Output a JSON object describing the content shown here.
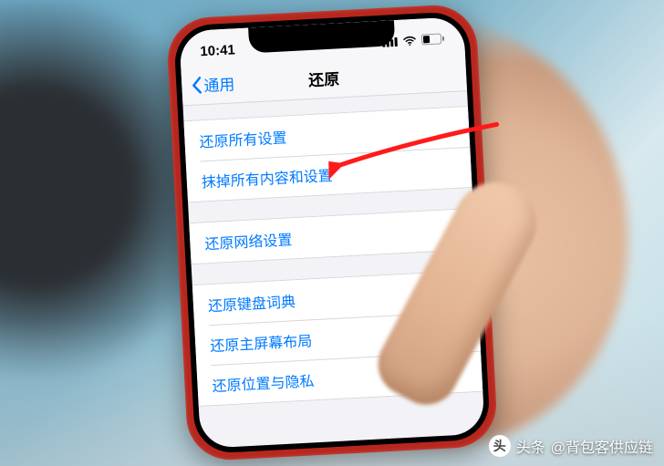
{
  "status_bar": {
    "time": "10:41"
  },
  "nav": {
    "back_label": "通用",
    "title": "还原"
  },
  "groups": [
    {
      "rows": [
        {
          "label": "还原所有设置"
        },
        {
          "label": "抹掉所有内容和设置"
        }
      ]
    },
    {
      "rows": [
        {
          "label": "还原网络设置"
        }
      ]
    },
    {
      "rows": [
        {
          "label": "还原键盘词典"
        },
        {
          "label": "还原主屏幕布局"
        },
        {
          "label": "还原位置与隐私"
        }
      ]
    }
  ],
  "attribution": {
    "prefix": "头条",
    "handle": "@背包客供应链"
  }
}
